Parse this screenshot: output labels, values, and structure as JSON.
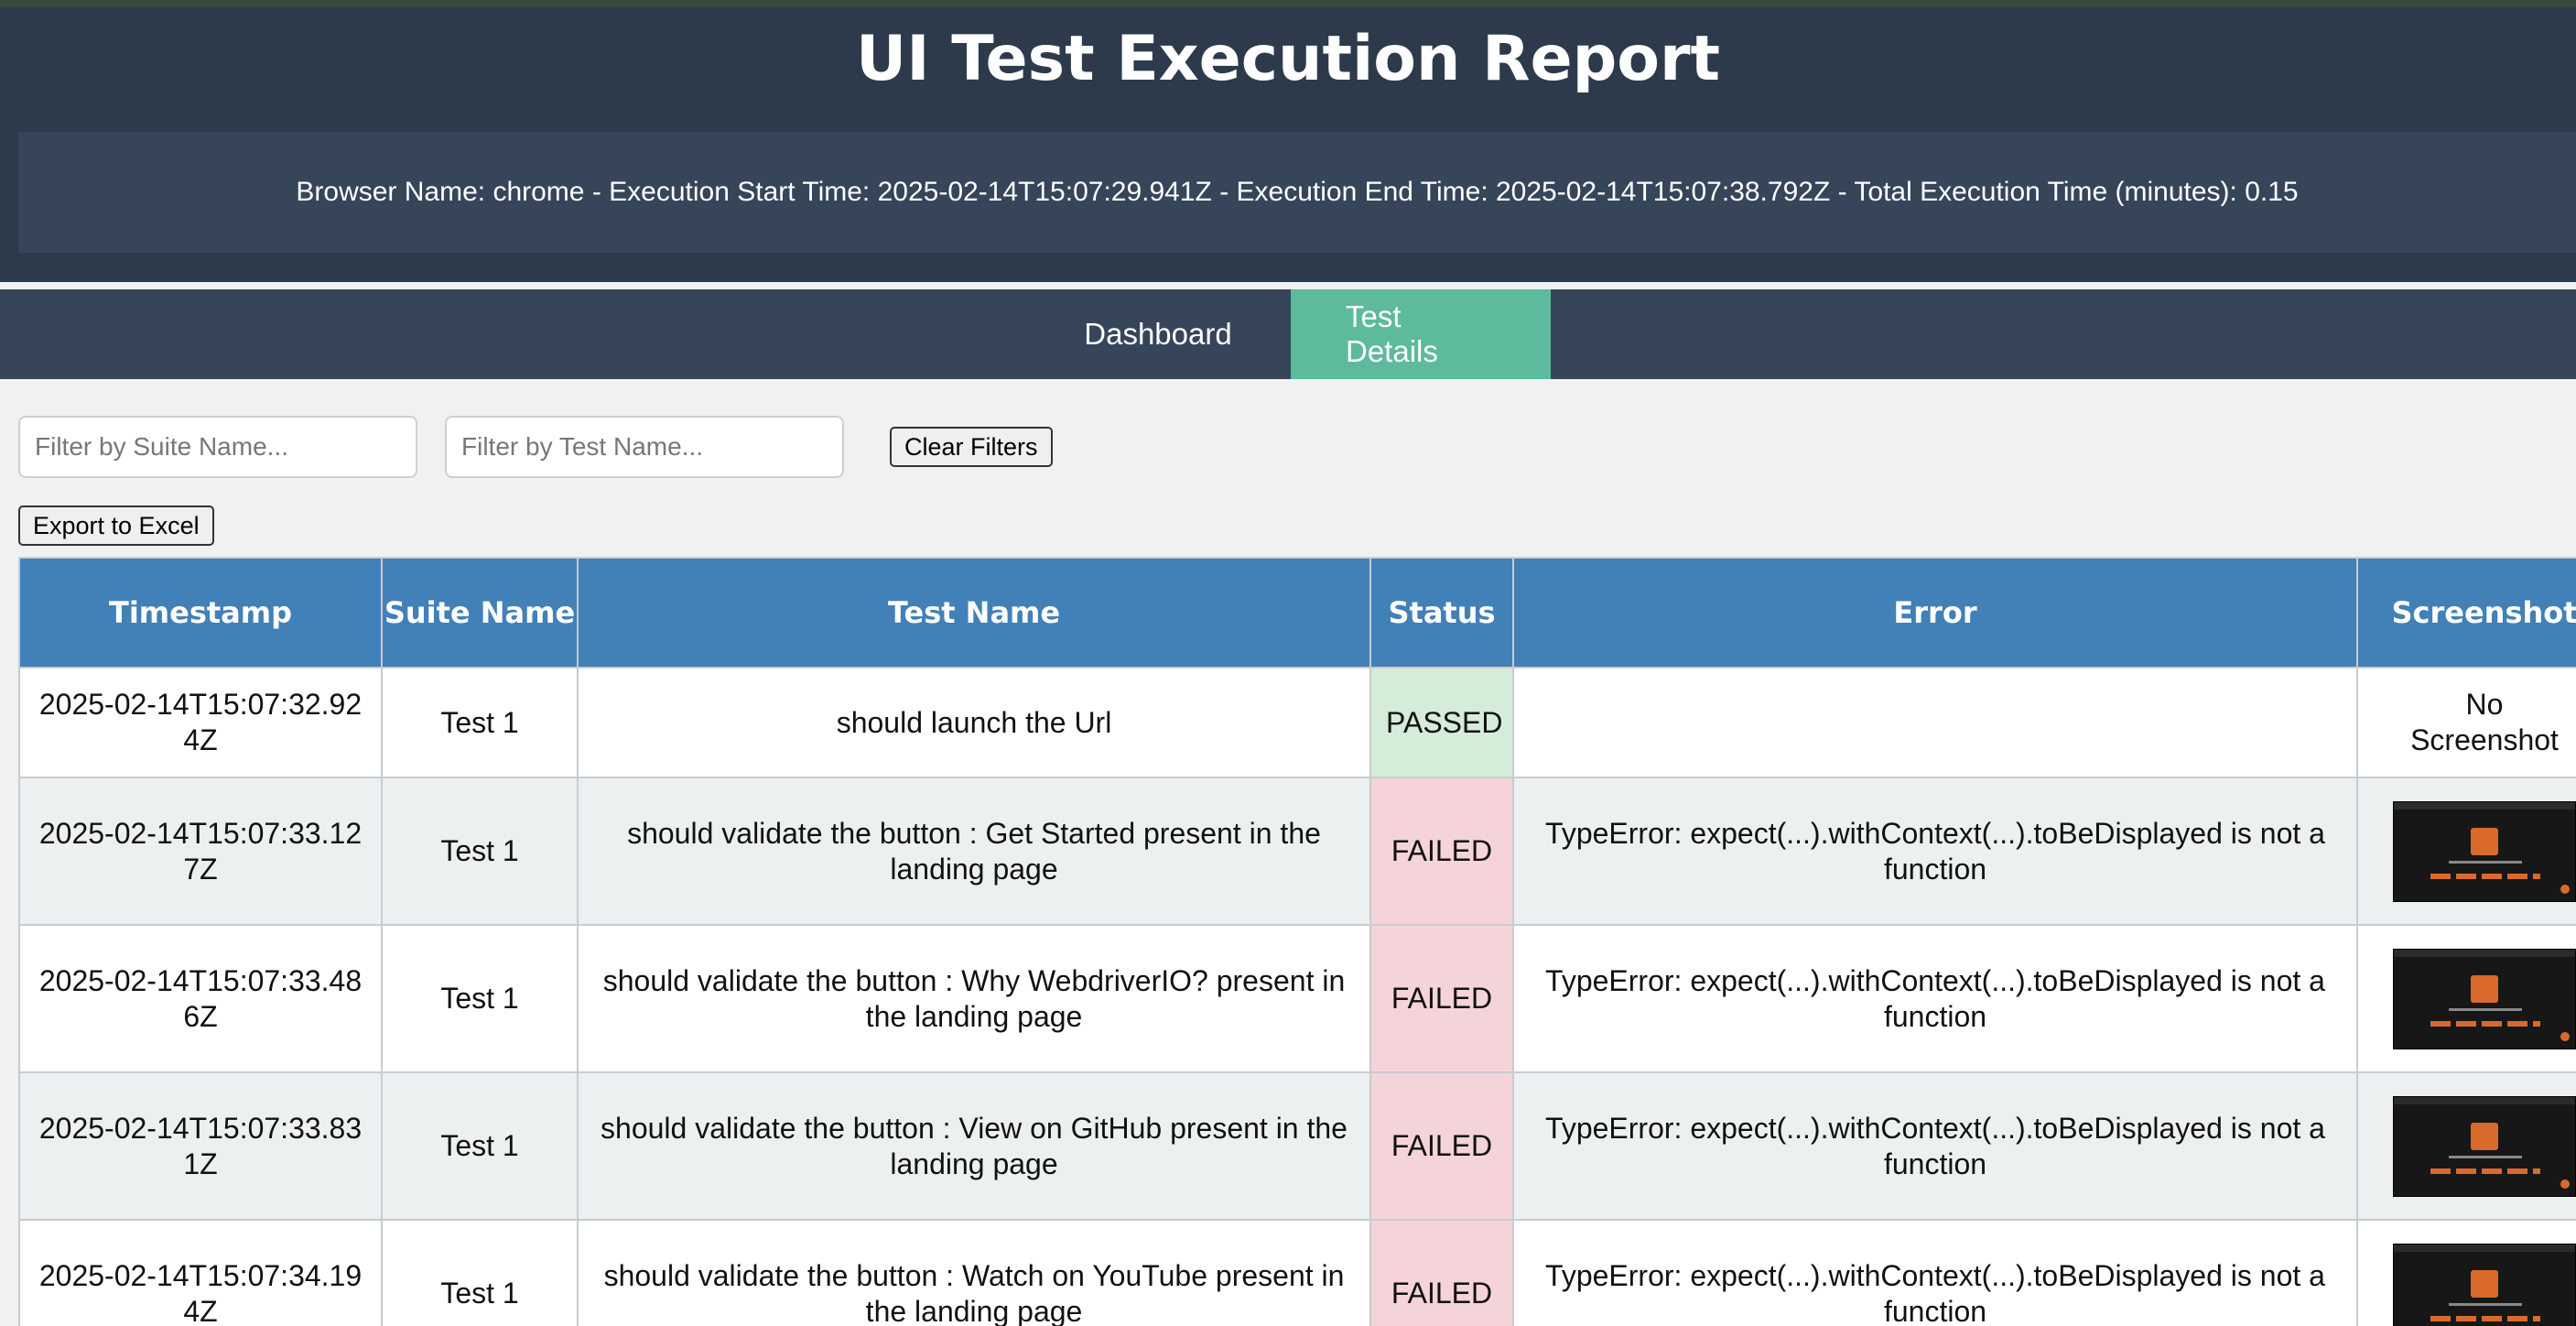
{
  "header": {
    "title": "UI Test Execution Report",
    "execution_info": "Browser Name: chrome - Execution Start Time: 2025-02-14T15:07:29.941Z - Execution End Time: 2025-02-14T15:07:38.792Z - Total Execution Time (minutes): 0.15"
  },
  "tabs": [
    {
      "label": "Dashboard",
      "active": false
    },
    {
      "label": "Test Details",
      "active": true
    }
  ],
  "filters": {
    "suite_placeholder": "Filter by Suite Name...",
    "test_placeholder": "Filter by Test Name...",
    "clear_label": "Clear Filters",
    "export_label": "Export to Excel"
  },
  "table": {
    "columns": [
      "Timestamp",
      "Suite Name",
      "Test Name",
      "Status",
      "Error",
      "Screenshot"
    ],
    "rows": [
      {
        "timestamp": "2025-02-14T15:07:32.924Z",
        "suite": "Test 1",
        "test": "should launch the Url",
        "status": "PASSED",
        "error": "",
        "screenshot": "No Screenshot"
      },
      {
        "timestamp": "2025-02-14T15:07:33.127Z",
        "suite": "Test 1",
        "test": "should validate the button : Get Started present in the landing page",
        "status": "FAILED",
        "error": "TypeError: expect(...).withContext(...).toBeDisplayed is not a function",
        "screenshot": ""
      },
      {
        "timestamp": "2025-02-14T15:07:33.486Z",
        "suite": "Test 1",
        "test": "should validate the button : Why WebdriverIO? present in the landing page",
        "status": "FAILED",
        "error": "TypeError: expect(...).withContext(...).toBeDisplayed is not a function",
        "screenshot": ""
      },
      {
        "timestamp": "2025-02-14T15:07:33.831Z",
        "suite": "Test 1",
        "test": "should validate the button : View on GitHub present in the landing page",
        "status": "FAILED",
        "error": "TypeError: expect(...).withContext(...).toBeDisplayed is not a function",
        "screenshot": ""
      },
      {
        "timestamp": "2025-02-14T15:07:34.194Z",
        "suite": "Test 1",
        "test": "should validate the button : Watch on YouTube present in the landing page",
        "status": "FAILED",
        "error": "TypeError: expect(...).withContext(...).toBeDisplayed is not a function",
        "screenshot": ""
      }
    ]
  }
}
